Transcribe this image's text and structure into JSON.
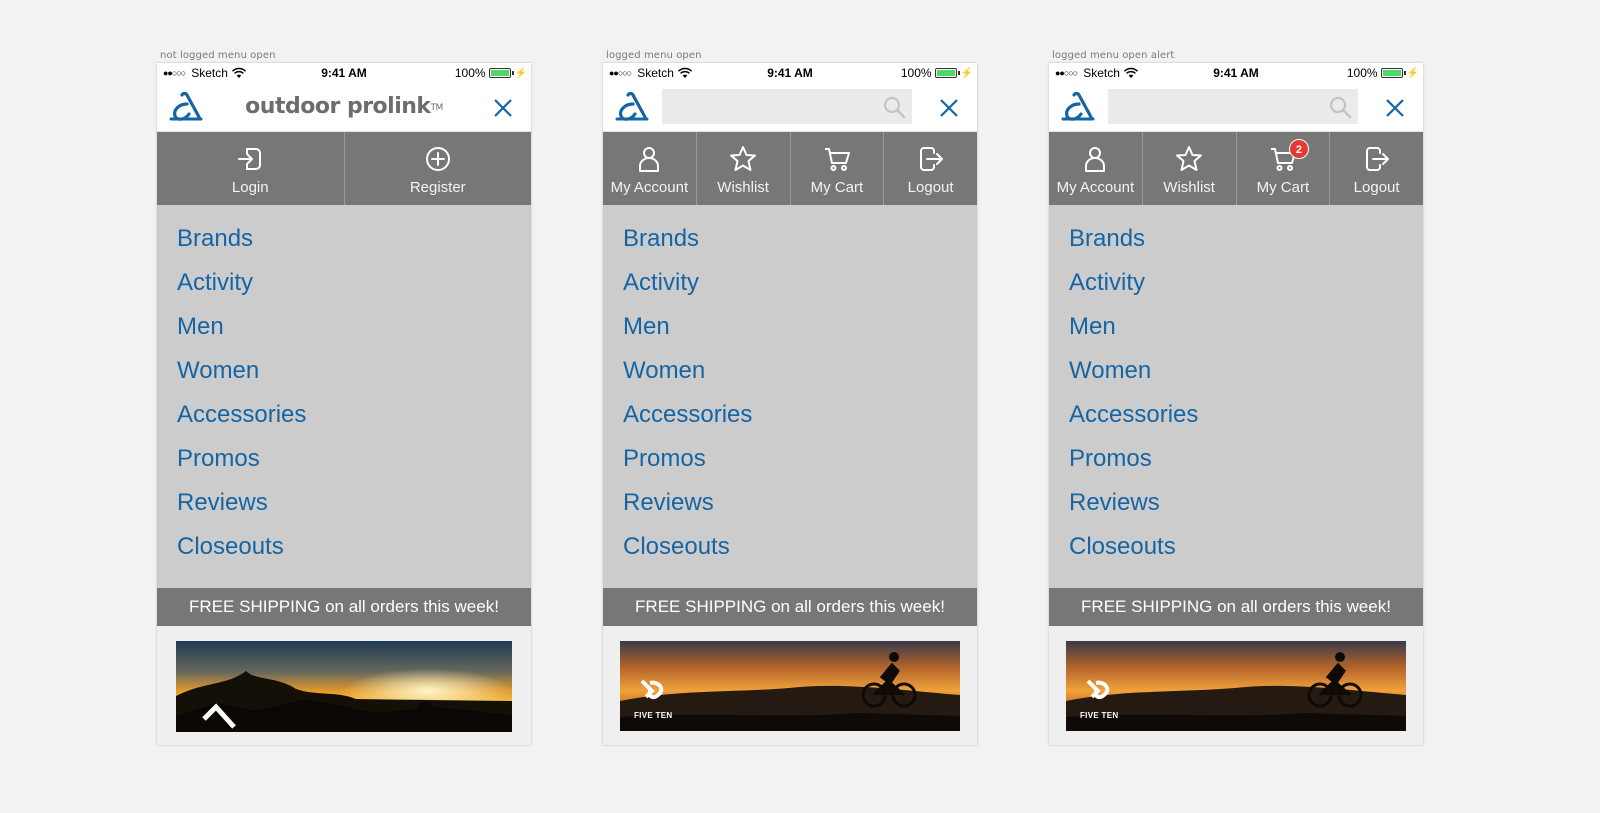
{
  "status_bar": {
    "signal": "●●○○○",
    "carrier": "Sketch",
    "time": "9:41 AM",
    "battery_percent": "100%",
    "battery_color": "#4cd964"
  },
  "brand": {
    "name": "outdoor prolink",
    "tm": "TM",
    "color": "#6d6d6d",
    "link_color": "#1565a5"
  },
  "artboards": [
    {
      "label": "not logged menu open",
      "header_mode": "logo",
      "actions": [
        {
          "label": "Login",
          "icon": "login-icon"
        },
        {
          "label": "Register",
          "icon": "plus-circle-icon"
        }
      ]
    },
    {
      "label": "logged menu open",
      "header_mode": "search",
      "actions": [
        {
          "label": "My Account",
          "icon": "user-icon"
        },
        {
          "label": "Wishlist",
          "icon": "star-icon"
        },
        {
          "label": "My Cart",
          "icon": "cart-icon"
        },
        {
          "label": "Logout",
          "icon": "logout-icon"
        }
      ]
    },
    {
      "label": "logged menu open alert",
      "header_mode": "search",
      "actions": [
        {
          "label": "My Account",
          "icon": "user-icon"
        },
        {
          "label": "Wishlist",
          "icon": "star-icon"
        },
        {
          "label": "My Cart",
          "icon": "cart-icon",
          "badge": "2"
        },
        {
          "label": "Logout",
          "icon": "logout-icon"
        }
      ]
    }
  ],
  "menu": {
    "items": [
      "Brands",
      "Activity",
      "Men",
      "Women",
      "Accessories",
      "Promos",
      "Reviews",
      "Closeouts"
    ]
  },
  "promo": {
    "shipping_text": "FREE SHIPPING on all orders this week!",
    "banner_brand": "FIVE TEN"
  }
}
